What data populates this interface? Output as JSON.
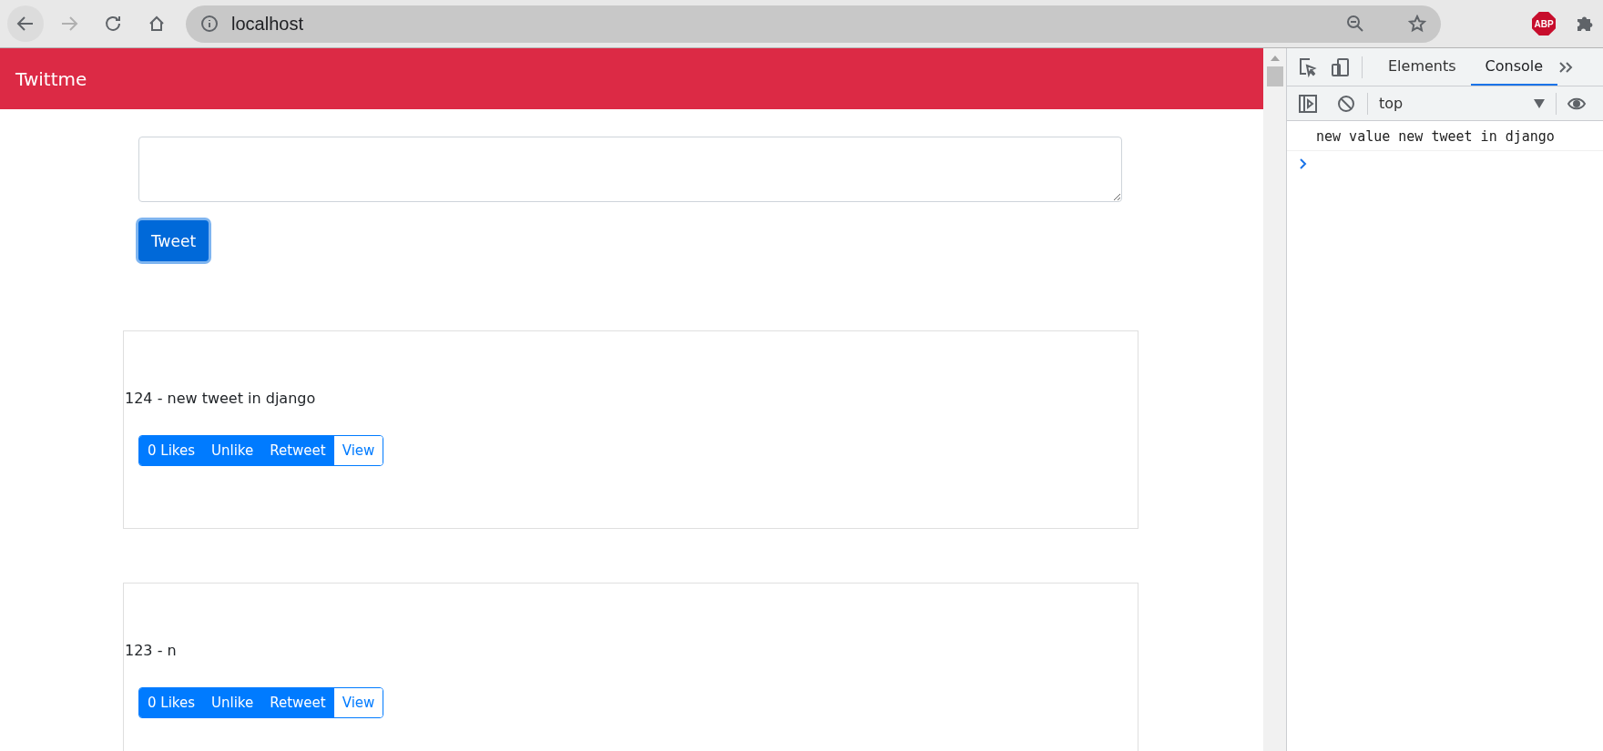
{
  "browser": {
    "address": "localhost",
    "back_enabled": true,
    "forward_enabled": false,
    "extension_badge": "ABP"
  },
  "navbar": {
    "brand": "Twittme"
  },
  "composer": {
    "button": "Tweet"
  },
  "tweets": [
    {
      "text": "124 - new tweet in django",
      "actions": [
        {
          "label": "0 Likes",
          "kind": "solid"
        },
        {
          "label": "Unlike",
          "kind": "solid"
        },
        {
          "label": "Retweet",
          "kind": "solid"
        },
        {
          "label": "View",
          "kind": "outline"
        }
      ]
    },
    {
      "text": "123 - n",
      "actions": [
        {
          "label": "0 Likes",
          "kind": "solid"
        },
        {
          "label": "Unlike",
          "kind": "solid"
        },
        {
          "label": "Retweet",
          "kind": "solid"
        },
        {
          "label": "View",
          "kind": "outline"
        }
      ]
    }
  ],
  "devtools": {
    "tabs": [
      {
        "label": "Elements",
        "selected": false
      },
      {
        "label": "Console",
        "selected": true
      }
    ],
    "context": "top",
    "messages": [
      "new value new tweet in django"
    ]
  }
}
